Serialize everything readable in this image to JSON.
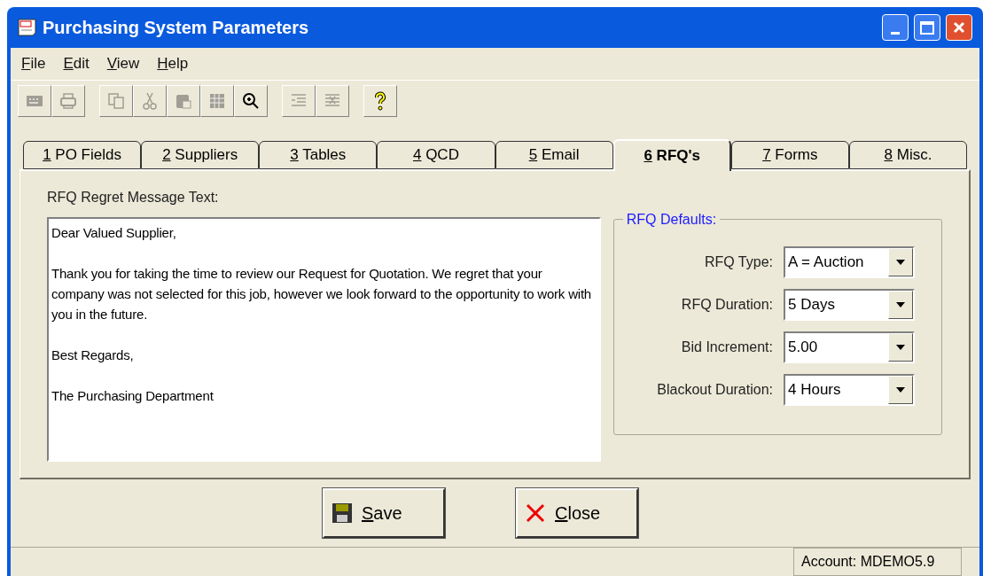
{
  "window": {
    "title": "Purchasing System Parameters"
  },
  "menu": [
    "File",
    "Edit",
    "View",
    "Help"
  ],
  "toolbar": [
    {
      "kind": "keyboard",
      "disabled": true
    },
    {
      "kind": "print",
      "disabled": true
    },
    {
      "kind": "copy",
      "disabled": true
    },
    {
      "kind": "cut",
      "disabled": true
    },
    {
      "kind": "paste",
      "disabled": true
    },
    {
      "kind": "grid",
      "disabled": true
    },
    {
      "kind": "zoom",
      "disabled": false
    },
    {
      "kind": "indent",
      "disabled": true
    },
    {
      "kind": "outdent",
      "disabled": true
    },
    {
      "kind": "help",
      "disabled": false
    }
  ],
  "tabs": [
    {
      "label": "1 PO Fields",
      "selected": false
    },
    {
      "label": "2 Suppliers",
      "selected": false
    },
    {
      "label": "3 Tables",
      "selected": false
    },
    {
      "label": "4 QCD",
      "selected": false
    },
    {
      "label": "5 Email",
      "selected": false
    },
    {
      "label": "6 RFQ's",
      "selected": true
    },
    {
      "label": "7 Forms",
      "selected": false
    },
    {
      "label": "8 Misc.",
      "selected": false
    }
  ],
  "message": {
    "label": "RFQ Regret Message Text:",
    "paragraphs": [
      "Dear Valued Supplier,",
      "Thank you for taking the time to review our Request for Quotation. We regret that your company was not selected for this job, however we look forward to the opportunity to work with you in the future.",
      "Best Regards,",
      "The Purchasing Department"
    ]
  },
  "defaults": {
    "title": "RFQ Defaults:",
    "fields": [
      {
        "label": "RFQ Type:",
        "value": "A = Auction"
      },
      {
        "label": "RFQ Duration:",
        "value": "5 Days"
      },
      {
        "label": "Bid Increment:",
        "value": "5.00"
      },
      {
        "label": "Blackout Duration:",
        "value": "4 Hours"
      }
    ]
  },
  "buttons": [
    {
      "kind": "save",
      "label": "Save"
    },
    {
      "kind": "close",
      "label": "Close"
    }
  ],
  "status_bar": {
    "account": "Account: MDEMO5.9"
  }
}
